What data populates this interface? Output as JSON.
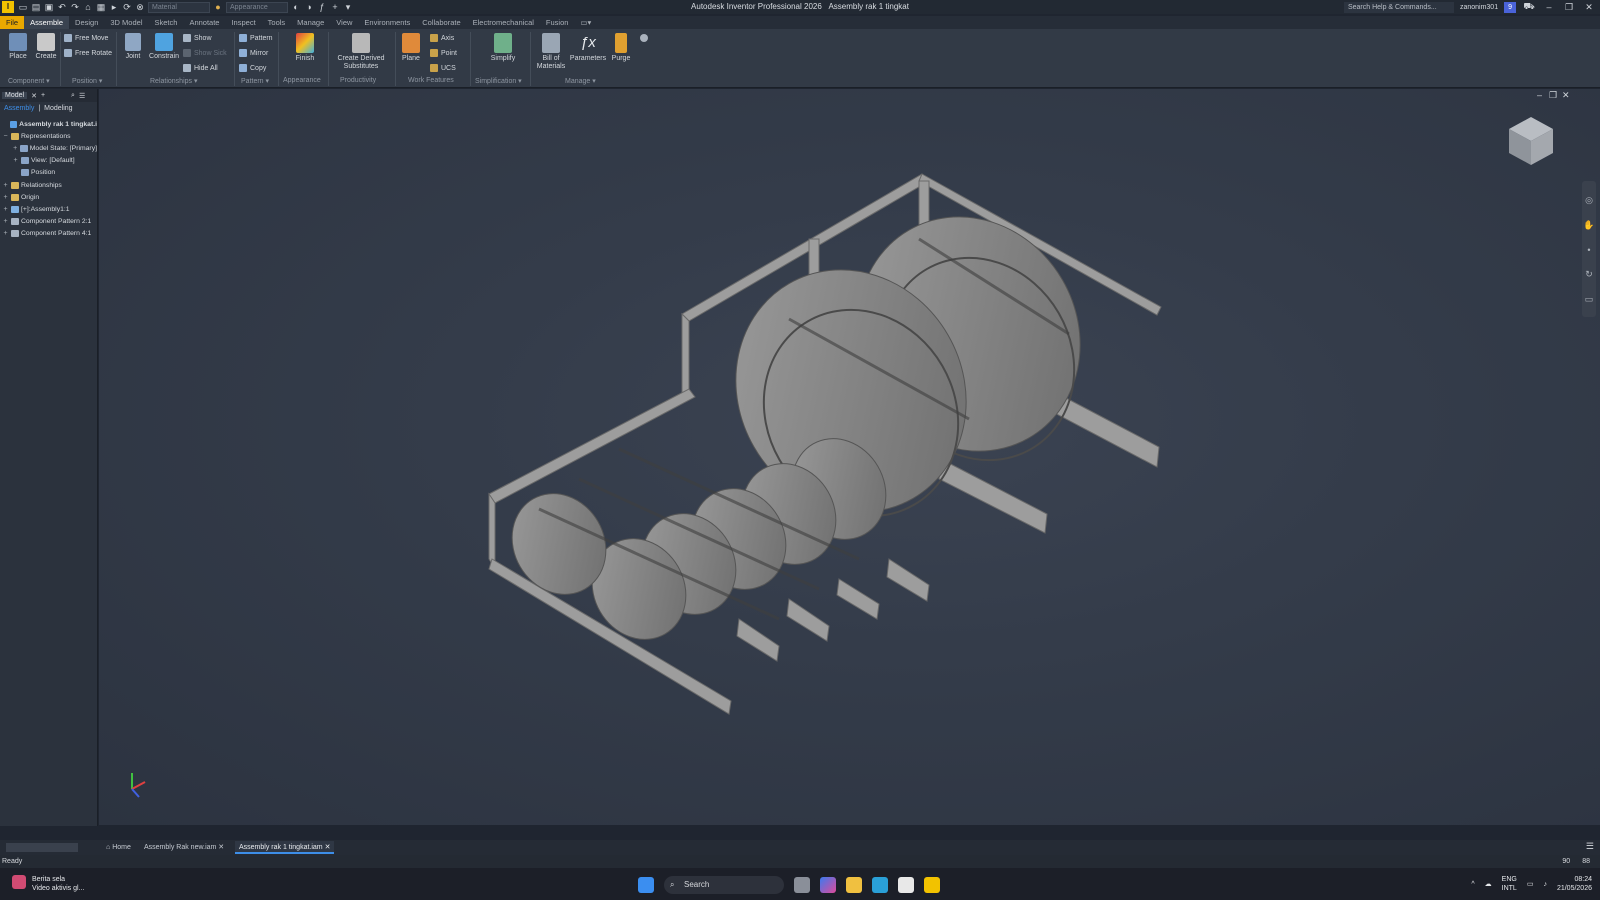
{
  "window": {
    "app_logo": "I",
    "title": "Autodesk Inventor Professional 2026",
    "document_title": "Assembly rak 1 tingkat",
    "material_placeholder": "Material",
    "appearance_placeholder": "Appearance",
    "help_search": "Search Help & Commands...",
    "user": "zanonim301",
    "notif_count": "9"
  },
  "menu_tabs": [
    "File",
    "Assemble",
    "Design",
    "3D Model",
    "Sketch",
    "Annotate",
    "Inspect",
    "Tools",
    "Manage",
    "View",
    "Environments",
    "Collaborate",
    "Electromechanical",
    "Fusion"
  ],
  "ribbon": {
    "place": "Place",
    "create": "Create",
    "free_move": "Free Move",
    "free_rotate": "Free Rotate",
    "joint": "Joint",
    "constrain": "Constrain",
    "show": "Show",
    "show_sick": "Show Sick",
    "hide_all": "Hide All",
    "pattern": "Pattern",
    "mirror": "Mirror",
    "copy": "Copy",
    "finish": "Finish",
    "create_derived": "Create Derived",
    "substitutes": "Substitutes",
    "plane": "Plane",
    "axis": "Axis",
    "point": "Point",
    "ucs": "UCS",
    "simplify": "Simplify",
    "bill_of": "Bill of",
    "materials": "Materials",
    "parameters": "Parameters",
    "purge": "Purge",
    "groups": {
      "component": "Component ▾",
      "position": "Position ▾",
      "relationships": "Relationships ▾",
      "pattern": "Pattern ▾",
      "appearance": "Appearance",
      "productivity": "Productivity",
      "work_features": "Work Features",
      "simplification": "Simplification ▾",
      "manage": "Manage ▾"
    }
  },
  "browser": {
    "tab": "Model",
    "sub_assembly": "Assembly",
    "sub_modeling": "Modeling",
    "tree": [
      {
        "label": "Assembly rak 1 tingkat.i",
        "exp": "",
        "root": true,
        "color": "#5aa0e6",
        "indent": 0
      },
      {
        "label": "Representations",
        "exp": "−",
        "color": "#d9b65a",
        "indent": 0
      },
      {
        "label": "Model State: [Primary]",
        "exp": "+",
        "color": "#8aa4c8",
        "indent": 2
      },
      {
        "label": "View: [Default]",
        "exp": "+",
        "color": "#8aa4c8",
        "indent": 2
      },
      {
        "label": "Position",
        "exp": "",
        "color": "#8aa4c8",
        "indent": 2
      },
      {
        "label": "Relationships",
        "exp": "+",
        "color": "#d9b65a",
        "indent": 0
      },
      {
        "label": "Origin",
        "exp": "+",
        "color": "#d9b65a",
        "indent": 0
      },
      {
        "label": "[+]:Assembly1:1",
        "exp": "+",
        "color": "#7fb0e0",
        "indent": 0
      },
      {
        "label": "Component Pattern 2:1",
        "exp": "+",
        "color": "#a7b3c2",
        "indent": 0
      },
      {
        "label": "Component Pattern 4:1",
        "exp": "+",
        "color": "#a7b3c2",
        "indent": 0
      }
    ]
  },
  "doc_tabs": {
    "home": "Home",
    "tab1": "Assembly Rak new.iam",
    "tab2": "Assembly rak 1 tingkat.iam"
  },
  "status": {
    "text": "Ready",
    "num1": "90",
    "num2": "88"
  },
  "taskbar": {
    "news_title": "Berita sela",
    "news_sub": "Video aktivis gl...",
    "search": "Search",
    "lang1": "ENG",
    "lang2": "INTL",
    "time": "08:24",
    "date": "21/05/2026"
  }
}
